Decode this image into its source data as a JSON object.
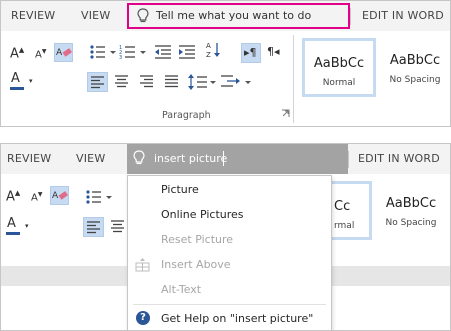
{
  "ribbon": {
    "tabs": {
      "review": "REVIEW",
      "view": "VIEW",
      "edit_in_word": "EDIT IN WORD"
    },
    "tell_me_placeholder": "Tell me what you want to do",
    "paragraph_group_label": "Paragraph",
    "styles": [
      {
        "sample": "AaBbCc",
        "name": "Normal"
      },
      {
        "sample": "AaBbCc",
        "name": "No Spacing"
      }
    ],
    "highlight_color": "#e0008a",
    "accent_blue": "#2b579a"
  },
  "search": {
    "query": "insert picture",
    "results": [
      {
        "label": "Picture",
        "enabled": true
      },
      {
        "label": "Online Pictures",
        "enabled": true
      },
      {
        "label": "Reset Picture",
        "enabled": false
      },
      {
        "label": "Insert Above",
        "enabled": false
      },
      {
        "label": "Alt-Text",
        "enabled": false
      }
    ],
    "help_label": "Get Help on \"insert picture\""
  },
  "styles_partial": [
    {
      "sample": "Cc",
      "name": "rmal"
    },
    {
      "sample": "AaBbCc",
      "name": "No Spacing"
    }
  ]
}
